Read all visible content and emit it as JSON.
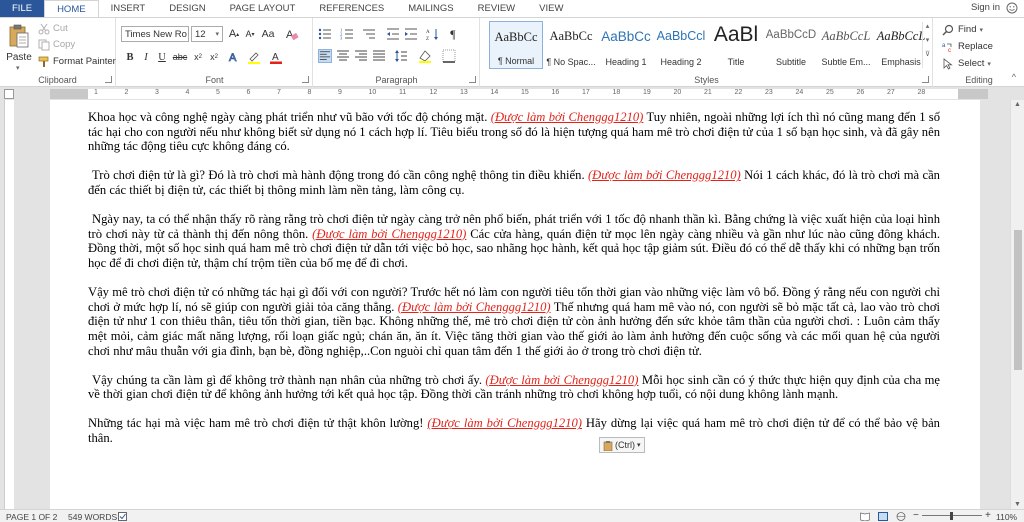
{
  "tabs": [
    "FILE",
    "HOME",
    "INSERT",
    "DESIGN",
    "PAGE LAYOUT",
    "REFERENCES",
    "MAILINGS",
    "REVIEW",
    "VIEW"
  ],
  "signin": "Sign in",
  "clipboard": {
    "paste": "Paste",
    "cut": "Cut",
    "copy": "Copy",
    "format_painter": "Format Painter",
    "label": "Clipboard"
  },
  "font": {
    "name": "Times New Ro",
    "size": "12",
    "label": "Font"
  },
  "paragraph": {
    "label": "Paragraph"
  },
  "styles": {
    "label": "Styles",
    "items": [
      {
        "sample": "AaBbCc",
        "name": "¶ Normal"
      },
      {
        "sample": "AaBbCc",
        "name": "¶ No Spac..."
      },
      {
        "sample": "AaBbCc",
        "name": "Heading 1"
      },
      {
        "sample": "AaBbCcl",
        "name": "Heading 2"
      },
      {
        "sample": "AaBl",
        "name": "Title"
      },
      {
        "sample": "AaBbCcD",
        "name": "Subtitle"
      },
      {
        "sample": "AaBbCcL",
        "name": "Subtle Em..."
      },
      {
        "sample": "AaBbCcL",
        "name": "Emphasis"
      }
    ]
  },
  "editing": {
    "find": "Find",
    "replace": "Replace",
    "select": "Select",
    "label": "Editing"
  },
  "ruler_numbers": [
    "1",
    "2",
    "3",
    "4",
    "5",
    "6",
    "7",
    "8",
    "9",
    "10",
    "11",
    "12",
    "13",
    "14",
    "15",
    "16",
    "17",
    "18",
    "19",
    "20",
    "21",
    "22",
    "23",
    "24",
    "25",
    "26",
    "27",
    "28"
  ],
  "document": {
    "paragraphs": [
      {
        "indent": false,
        "before": "Khoa học và công nghệ ngày càng phát triển như vũ bão với tốc độ chóng mặt. ",
        "cite": "(Được làm bởi Chenggg1210)",
        "after": "  Tuy nhiên, ngoài những lợi ích thì nó cũng mang đến 1 số tác hại cho con người nếu như không biết sử dụng nó 1 cách hợp lí. Tiêu biểu trong số đó là hiện tượng quá ham mê trò chơi điện tử của 1 số bạn học sinh, và đã gây nên những tác động tiêu cực không đáng có."
      },
      {
        "indent": true,
        "before": " Trò chơi điện tử là gì? Đó là trò chơi mà hành động trong đó cần công nghệ thông tin điều khiển. ",
        "cite": "(Được làm bởi Chenggg1210)",
        "after": " Nói 1 cách khác, đó là trò chơi mà cần đến các thiết bị điện tử, các thiết bị thông minh làm nền tảng, làm công cụ."
      },
      {
        "indent": true,
        "before": " Ngày nay, ta có thể nhận thấy rõ ràng rằng trò chơi điện tử ngày càng trở nên phổ biến, phát triển với 1 tốc độ nhanh thần kì. Bằng chứng là việc xuất hiện của loại hình trò chơi này từ cả thành thị đến nông thôn. ",
        "cite": "(Được làm bởi Chenggg1210)",
        "after": " Các cửa hàng, quán điện tử mọc lên ngày càng nhiều và gần như lúc nào cũng đông khách. Đồng thời, một số học sinh quá ham mê trò chơi điện tử dẫn tới việc bỏ học, sao nhãng học hành, kết quả học tập giảm sút. Điều đó có thể dễ thấy khi có những bạn trốn học để đi chơi điện tử, thậm chí trộm tiền của bố mẹ để đi chơi."
      },
      {
        "indent": false,
        "before": "Vậy mê trò chơi điện tử có những tác hại gì đối với con người? Trước hết nó làm con người tiêu tốn thời gian vào những việc làm vô bổ. Đồng ý rằng nếu con người chỉ chơi ở mức hợp lí, nó sẽ giúp con người giải tỏa căng thẳng. ",
        "cite": "(Được làm bởi Chenggg1210)",
        "after": " Thế nhưng quá ham mê vào nó, con người sẽ bỏ mặc tất cả, lao vào trò chơi điện tử như 1 con thiêu thân, tiêu tốn thời gian, tiền bạc. Không những thế, mê trò chơi điện tử còn ảnh hưởng đến sức khỏe tâm thần của người chơi. : Luôn cảm thấy mệt mỏi, cảm giác mất năng lượng, rối loạn giấc ngủ; chán ăn, ăn ít. Việc tăng thời gian vào thế giới ảo làm ảnh hưởng đến cuộc sống và các mối quan hệ của người chơi như mâu thuẫn với gia đình, bạn bè, đồng nghiệp,..Con nguòi chỉ quan tâm đến 1 thế giới ảo ở trong trò chơi điện tử."
      },
      {
        "indent": true,
        "before": " Vậy chúng ta cần làm gì để không trở thành nạn nhân của những trò chơi ấy. ",
        "cite": "(Được làm bởi Chenggg1210)",
        "after": " Mỗi học sinh cần có ý thức thực hiện quy định của cha mẹ về thời gian chơi điện tử để không ảnh hưởng tới kết quả học tập. Đồng thời cần tránh những trò chơi không hợp tuổi, có nội dung không lành mạnh."
      },
      {
        "indent": false,
        "before": "Những tác hại  mà việc ham mê trò chơi điện tử thật khôn lường! ",
        "cite": "(Được làm bởi Chenggg1210)",
        "after": " Hãy dừng lại việc quá ham mê trò chơi điện tử để có thể bảo vệ bản thân."
      }
    ],
    "paste_options": "(Ctrl)"
  },
  "status": {
    "page": "PAGE 1 OF 2",
    "words": "549 WORDS",
    "zoom": "110%"
  },
  "colors": {
    "file_tab": "#2b579a",
    "citation": "#e2231a"
  }
}
